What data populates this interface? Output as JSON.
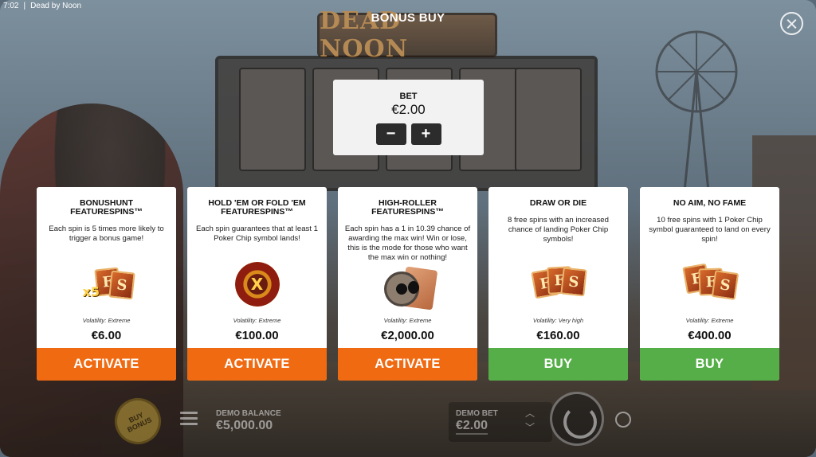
{
  "window": {
    "time": "7:02",
    "title": "Dead by Noon"
  },
  "game": {
    "logo": "DEAD NOON"
  },
  "dialog": {
    "title": "BONUS BUY"
  },
  "bet": {
    "label": "BET",
    "value": "€2.00",
    "minus": "−",
    "plus": "+"
  },
  "cards": [
    {
      "title_line1": "BONUSHUNT",
      "title_line2": "FEATURESPINS™",
      "description": "Each spin is 5 times more likely to trigger a bonus game!",
      "icon": "fs-x5-icon",
      "volatility": "Volatility: Extreme",
      "price": "€6.00",
      "action": "ACTIVATE",
      "action_color": "#f06a12"
    },
    {
      "title_line1": "HOLD 'EM OR FOLD 'EM",
      "title_line2": "FEATURESPINS™",
      "description": "Each spin guarantees that at least 1 Poker Chip symbol lands!",
      "icon": "poker-chip-icon",
      "volatility": "Volatility: Extreme",
      "price": "€100.00",
      "action": "ACTIVATE",
      "action_color": "#f06a12"
    },
    {
      "title_line1": "HIGH-ROLLER",
      "title_line2": "FEATURESPINS™",
      "description": "Each spin has a 1 in 10.39 chance of awarding the max win! Win or lose, this is the mode for those who want the max win or nothing!",
      "icon": "revolver-wanted-icon",
      "volatility": "Volatility: Extreme",
      "price": "€2,000.00",
      "action": "ACTIVATE",
      "action_color": "#f06a12"
    },
    {
      "title_line1": "DRAW OR DIE",
      "title_line2": "",
      "description": "8 free spins with an increased chance of landing Poker Chip symbols!",
      "icon": "fs-cards-icon",
      "volatility": "Volatility: Very high",
      "price": "€160.00",
      "action": "BUY",
      "action_color": "#56ae48"
    },
    {
      "title_line1": "NO AIM, NO FAME",
      "title_line2": "",
      "description": "10 free spins with 1 Poker Chip symbol guaranteed to land on every spin!",
      "icon": "fs-cards-icon",
      "volatility": "Volatility: Extreme",
      "price": "€400.00",
      "action": "BUY",
      "action_color": "#56ae48"
    }
  ],
  "bottom_bar": {
    "buy_bonus_label": "BUY BONUS",
    "balance_label": "DEMO BALANCE",
    "balance_value": "€5,000.00",
    "bet_label": "DEMO BET",
    "bet_value": "€2.00"
  }
}
